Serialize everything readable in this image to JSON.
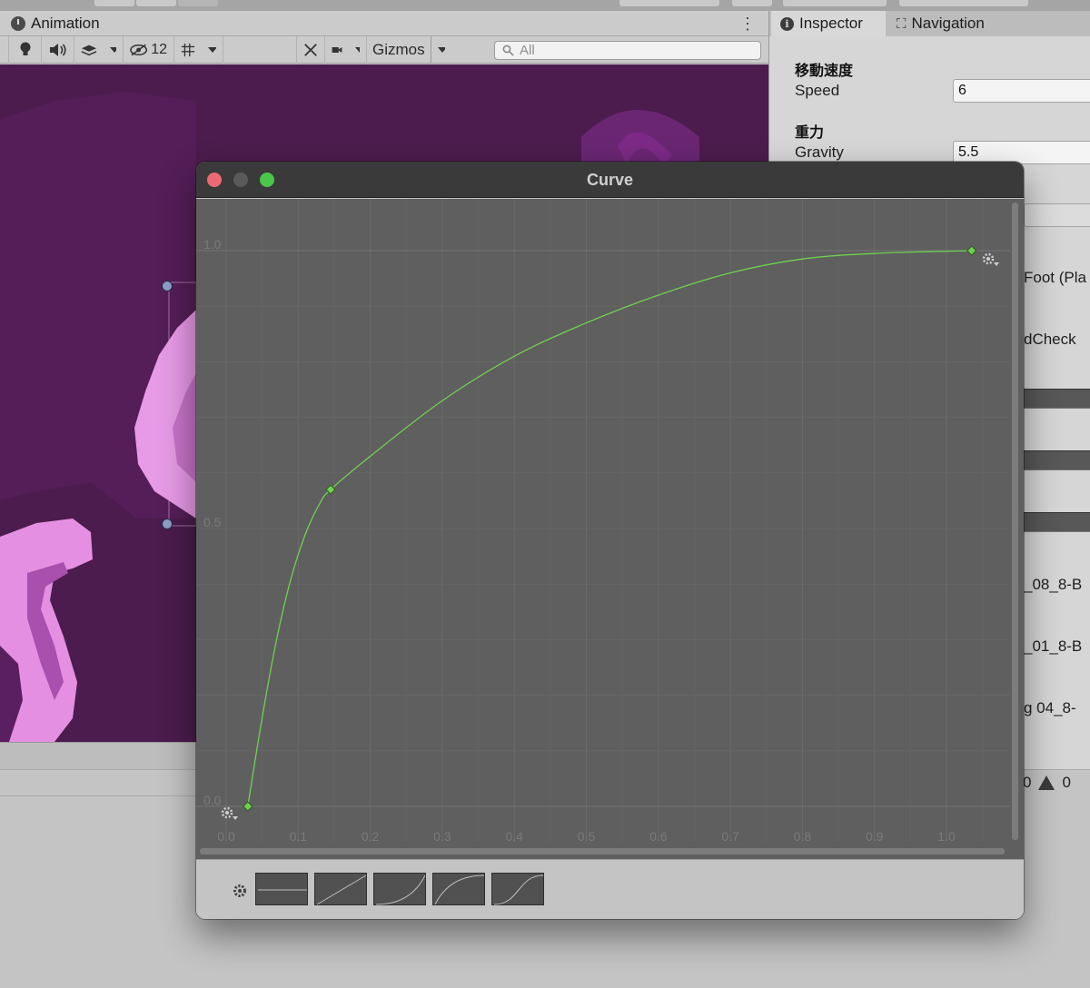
{
  "animation_window": {
    "tab_label": "Animation",
    "toolbar": {
      "hidden_count": "12",
      "gizmos_label": "Gizmos",
      "search_placeholder": "All"
    }
  },
  "inspector": {
    "tabs": [
      {
        "label": "Inspector",
        "icon": "info-icon"
      },
      {
        "label": "Navigation",
        "icon": "navigation-icon"
      }
    ],
    "sections": [
      {
        "header": "移動速度",
        "label": "Speed",
        "value": "6"
      },
      {
        "header": "重力",
        "label": "Gravity",
        "value": "5.5"
      }
    ],
    "partial_rows": [
      "Foot (Pla",
      "dCheck",
      "_08_8-B",
      "_01_8-B",
      "g 04_8-"
    ],
    "console": {
      "log_count": "0",
      "warning_count": "0"
    }
  },
  "curve_window": {
    "title": "Curve",
    "curve_color": "#6fd14e",
    "chart_data": {
      "type": "line",
      "xlim": [
        0.0,
        1.0
      ],
      "ylim": [
        0.0,
        1.0
      ],
      "x_ticks": [
        "0.0",
        "0.1",
        "0.2",
        "0.3",
        "0.4",
        "0.5",
        "0.6",
        "0.7",
        "0.8",
        "0.9",
        "1.0"
      ],
      "y_ticks": [
        "0.0",
        "0.5",
        "1.0"
      ],
      "keyframes": [
        {
          "x": 0.03,
          "y": 0.0
        },
        {
          "x": 0.145,
          "y": 0.57
        },
        {
          "x": 1.035,
          "y": 1.0
        }
      ],
      "curve": [
        {
          "x": 0.03,
          "y": 0.0
        },
        {
          "x": 0.05,
          "y": 0.16
        },
        {
          "x": 0.07,
          "y": 0.3
        },
        {
          "x": 0.09,
          "y": 0.41
        },
        {
          "x": 0.11,
          "y": 0.49
        },
        {
          "x": 0.13,
          "y": 0.545
        },
        {
          "x": 0.145,
          "y": 0.57
        },
        {
          "x": 0.2,
          "y": 0.63
        },
        {
          "x": 0.3,
          "y": 0.73
        },
        {
          "x": 0.4,
          "y": 0.81
        },
        {
          "x": 0.5,
          "y": 0.87
        },
        {
          "x": 0.6,
          "y": 0.92
        },
        {
          "x": 0.7,
          "y": 0.96
        },
        {
          "x": 0.8,
          "y": 0.985
        },
        {
          "x": 0.9,
          "y": 0.995
        },
        {
          "x": 1.035,
          "y": 1.0
        }
      ]
    },
    "presets": [
      "constant",
      "linear",
      "ease-in",
      "ease-out",
      "ease-in-out"
    ]
  }
}
